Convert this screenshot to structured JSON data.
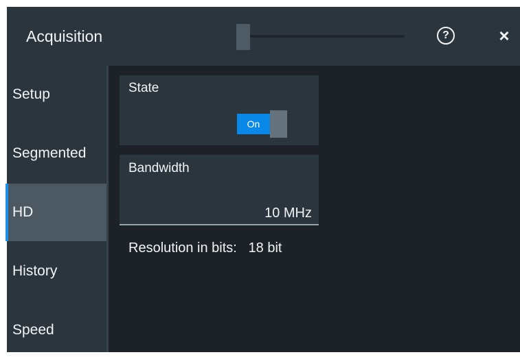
{
  "dialog": {
    "title": "Acquisition",
    "help_symbol": "?",
    "close_symbol": "×"
  },
  "sidebar": {
    "items": [
      {
        "label": "Setup"
      },
      {
        "label": "Segmented"
      },
      {
        "label": "HD"
      },
      {
        "label": "History"
      },
      {
        "label": "Speed"
      }
    ],
    "active": "HD"
  },
  "hd": {
    "state": {
      "label": "State",
      "toggle_text": "On"
    },
    "bandwidth": {
      "label": "Bandwidth",
      "value": "10 MHz"
    },
    "resolution": {
      "label": "Resolution in bits:",
      "value": "18 bit"
    }
  },
  "colors": {
    "accent": "#1e8fe6",
    "toggle_on": "#0a88e8",
    "background": "#1c2227",
    "panel": "#2b353d"
  },
  "icons": [
    "help-icon",
    "close-icon"
  ]
}
